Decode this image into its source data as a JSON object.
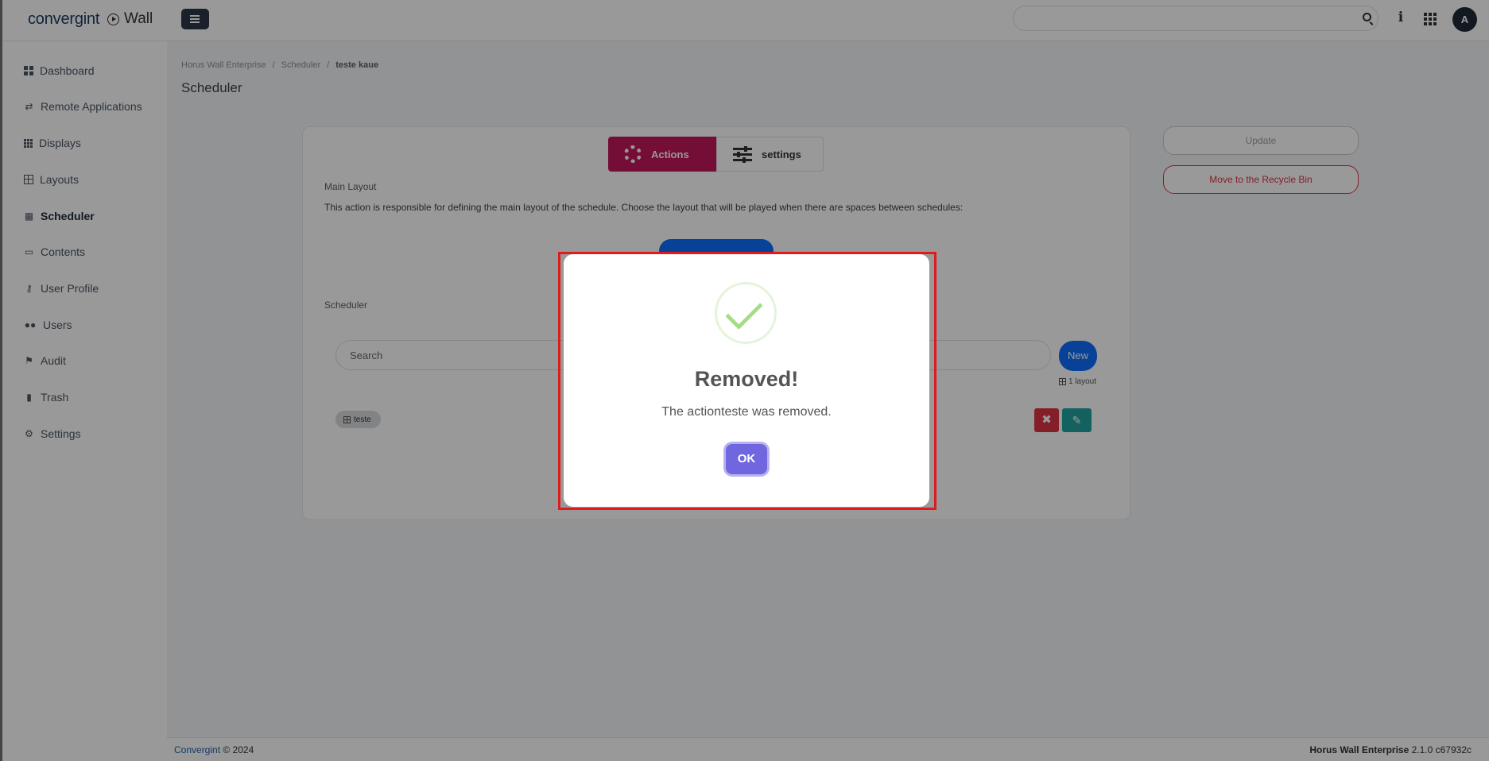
{
  "header": {
    "brand": "convergint",
    "app_name": "Wall",
    "avatar_initial": "A"
  },
  "sidebar": {
    "items": [
      {
        "label": "Dashboard",
        "icon": "dashboard-icon"
      },
      {
        "label": "Remote Applications",
        "icon": "remote-icon"
      },
      {
        "label": "Displays",
        "icon": "displays-icon"
      },
      {
        "label": "Layouts",
        "icon": "layouts-icon"
      },
      {
        "label": "Scheduler",
        "icon": "calendar-icon",
        "active": true
      },
      {
        "label": "Contents",
        "icon": "image-icon"
      },
      {
        "label": "User Profile",
        "icon": "key-icon"
      },
      {
        "label": "Users",
        "icon": "users-icon"
      },
      {
        "label": "Audit",
        "icon": "flag-icon"
      },
      {
        "label": "Trash",
        "icon": "trash-icon"
      },
      {
        "label": "Settings",
        "icon": "gear-icon"
      }
    ]
  },
  "breadcrumb": [
    "Horus Wall Enterprise",
    "Scheduler",
    "teste kaue"
  ],
  "breadcrumb_sep": "/",
  "page_title": "Scheduler",
  "tabs": {
    "actions": "Actions",
    "settings": "settings"
  },
  "main_layout": {
    "label": "Main Layout",
    "description": "This action is responsible for defining the main layout of the schedule. Choose the layout that will be played when there are spaces between schedules:"
  },
  "scheduler": {
    "label": "Scheduler",
    "search_placeholder": "Search",
    "new_label": "New",
    "layout_count": "1 layout",
    "tag": "teste",
    "delete_glyph": "✖",
    "edit_glyph": "✎"
  },
  "side_buttons": {
    "update": "Update",
    "recycle": "Move to the Recycle Bin"
  },
  "footer": {
    "company": "Convergint",
    "copyright": "© 2024",
    "product": "Horus Wall Enterprise",
    "version": "2.1.0 c67932c"
  },
  "modal": {
    "title": "Removed!",
    "text": "The actionteste was removed.",
    "ok": "OK",
    "icon": "success-check-icon"
  },
  "colors": {
    "accent": "#c2185b",
    "primary": "#0d6efd",
    "danger": "#dc3545",
    "confirm": "#7066e0",
    "success": "#a5dc86"
  }
}
